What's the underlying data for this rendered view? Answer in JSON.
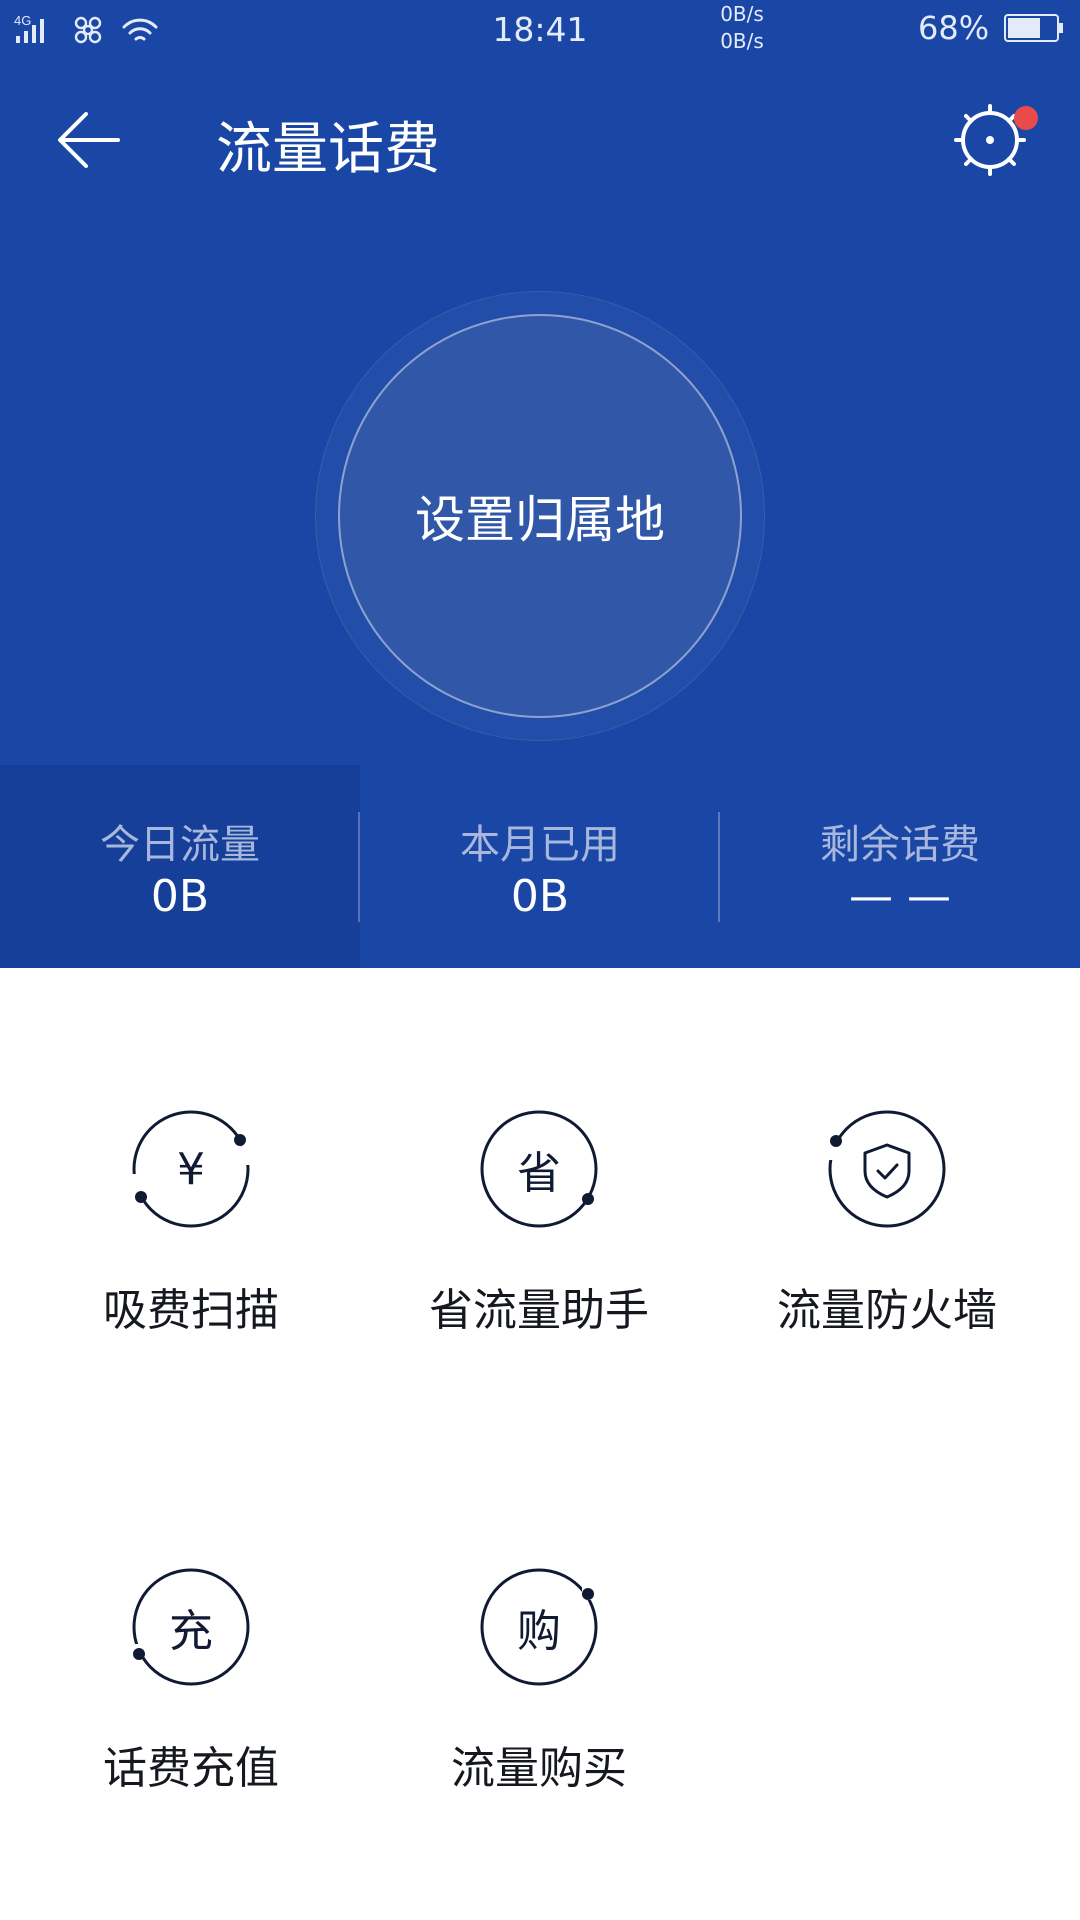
{
  "status_bar": {
    "network_type": "4G",
    "time": "18:41",
    "speed_up": "0B/s",
    "speed_down": "0B/s",
    "battery_percent": "68%",
    "battery_level": 0.68
  },
  "header": {
    "title": "流量话费",
    "back_icon": "arrow-left-icon",
    "settings_icon": "gear-icon"
  },
  "center_button": {
    "label": "设置归属地"
  },
  "stats": [
    {
      "label": "今日流量",
      "value": "0B"
    },
    {
      "label": "本月已用",
      "value": "0B"
    },
    {
      "label": "剩余话费",
      "value": "— —"
    }
  ],
  "features": [
    {
      "label": "吸费扫描",
      "glyph": "¥"
    },
    {
      "label": "省流量助手",
      "glyph": "省"
    },
    {
      "label": "流量防火墙",
      "glyph": ""
    },
    {
      "label": "话费充值",
      "glyph": "充"
    },
    {
      "label": "流量购买",
      "glyph": "购"
    }
  ],
  "colors": {
    "header_bg": "#1a47a6",
    "active_stat_bg": "#163f99",
    "notification_dot": "#e94b4b"
  }
}
